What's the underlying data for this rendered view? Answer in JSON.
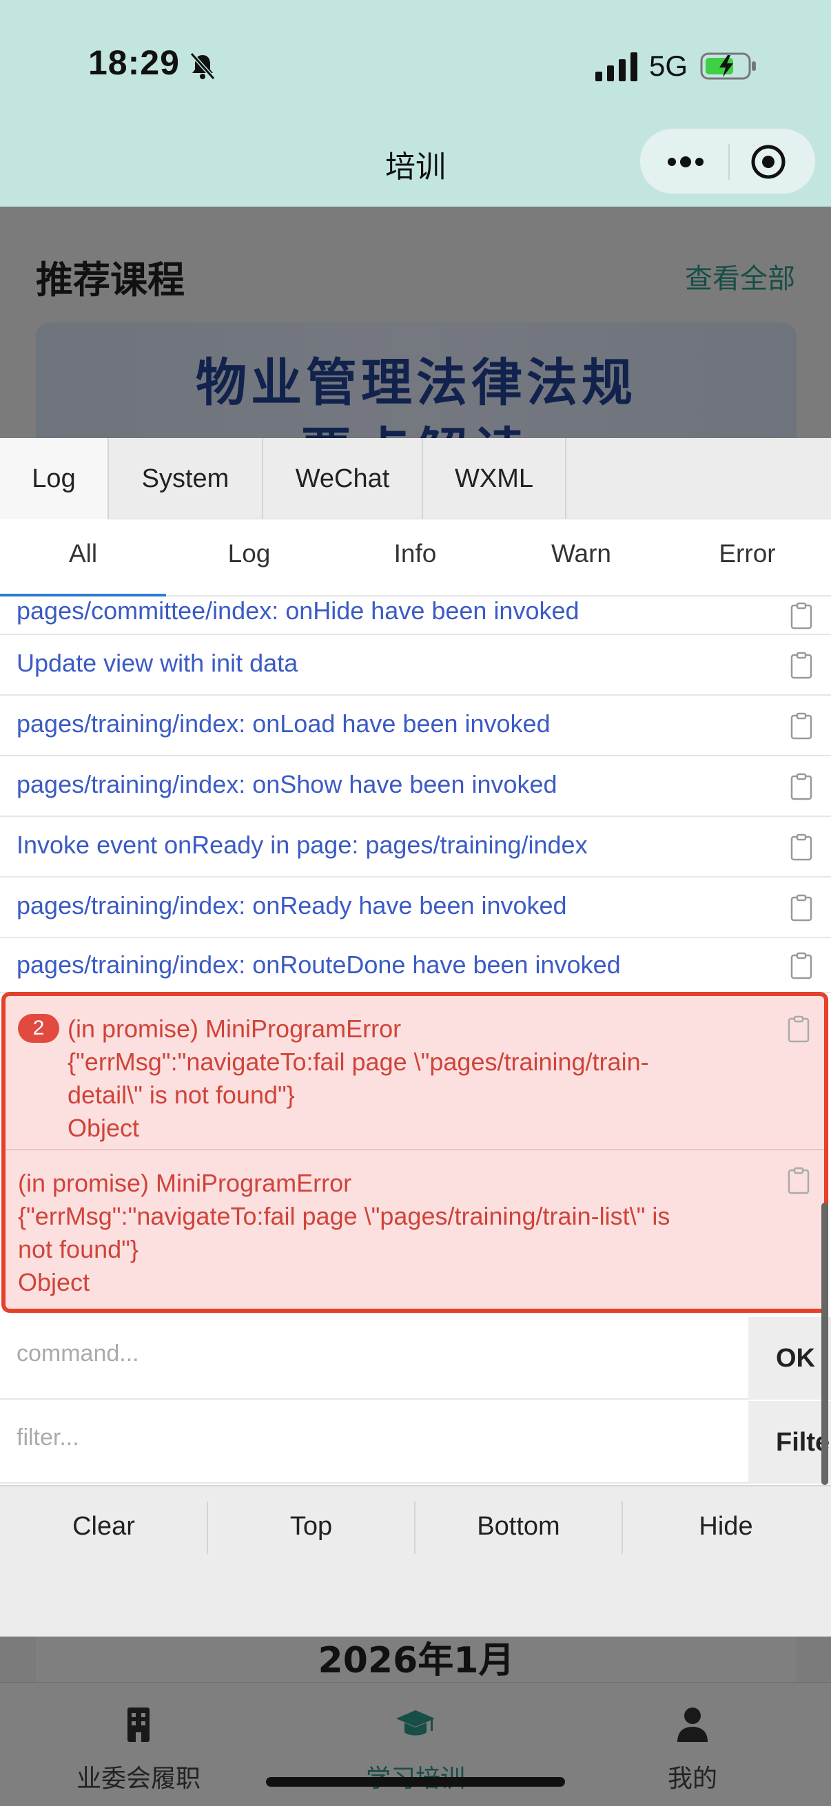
{
  "status_bar": {
    "time": "18:29",
    "network": "5G"
  },
  "nav": {
    "title": "培训"
  },
  "page": {
    "section_title": "推荐课程",
    "view_all": "查看全部",
    "banner_line1": "物业管理法律法规",
    "banner_line2": "要点解读",
    "month": "2026年1月",
    "tabbar": [
      {
        "label": "业委会履职",
        "icon": "building-icon"
      },
      {
        "label": "学习培训",
        "icon": "graduation-cap-icon"
      },
      {
        "label": "我的",
        "icon": "person-icon"
      }
    ]
  },
  "vconsole": {
    "tabs": [
      "Log",
      "System",
      "WeChat",
      "WXML"
    ],
    "subtabs": [
      "All",
      "Log",
      "Info",
      "Warn",
      "Error"
    ],
    "logs": [
      "pages/committee/index: onHide have been invoked",
      "Update view with init data",
      "pages/training/index: onLoad have been invoked",
      "pages/training/index: onShow have been invoked",
      "Invoke event onReady in page: pages/training/index",
      "pages/training/index: onReady have been invoked",
      "pages/training/index: onRouteDone have been invoked"
    ],
    "errors": [
      {
        "repeat": "2",
        "text": "(in promise) MiniProgramError\n{\"errMsg\":\"navigateTo:fail page \\\"pages/training/train-\ndetail\\\" is not found\"}\nObject"
      },
      {
        "text": "(in promise) MiniProgramError\n{\"errMsg\":\"navigateTo:fail page \\\"pages/training/train-list\\\" is\nnot found\"}\nObject"
      }
    ],
    "command_placeholder": "command...",
    "command_button": "OK",
    "filter_placeholder": "filter...",
    "filter_button": "Filter",
    "tools": [
      "Clear",
      "Top",
      "Bottom",
      "Hide"
    ]
  },
  "colors": {
    "header_bg": "#c2e5df",
    "accent": "#2f9d8c",
    "log_text": "#3b5bc4",
    "error_text": "#d0433a",
    "error_border": "#e4412b",
    "error_bg": "#fbe0df"
  }
}
